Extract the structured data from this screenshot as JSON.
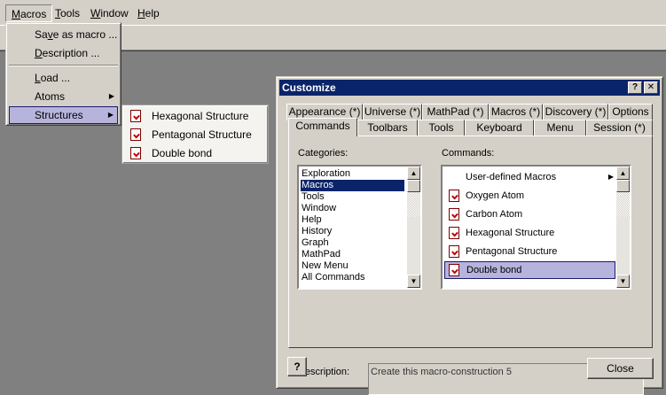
{
  "menubar": {
    "items": [
      {
        "label": "Macros",
        "mnemonic": "M",
        "rest": "acros"
      },
      {
        "label": "Tools",
        "mnemonic": "T",
        "rest": "ools"
      },
      {
        "label": "Window",
        "mnemonic": "W",
        "rest": "indow"
      },
      {
        "label": "Help",
        "mnemonic": "H",
        "rest": "elp"
      }
    ]
  },
  "macros_menu": {
    "save_as_macro": {
      "pre": "Sa",
      "mn": "v",
      "post": "e as macro ..."
    },
    "description": {
      "mn": "D",
      "post": "escription ..."
    },
    "load": {
      "mn": "L",
      "post": "oad ..."
    },
    "atoms": "Atoms",
    "structures": "Structures"
  },
  "structures_submenu": {
    "items": [
      "Hexagonal Structure",
      "Pentagonal Structure",
      "Double bond"
    ]
  },
  "dialog": {
    "title": "Customize",
    "help_btn": "?",
    "close_btn": "✕",
    "tabs_back": [
      "Appearance (*)",
      "Universe (*)",
      "MathPad (*)",
      "Macros (*)",
      "Discovery (*)",
      "Options"
    ],
    "tabs_front": [
      "Commands",
      "Toolbars",
      "Tools",
      "Keyboard",
      "Menu",
      "Session (*)"
    ],
    "categories_label": "Categories:",
    "categories": [
      "Exploration",
      "Macros",
      "Tools",
      "Window",
      "Help",
      "History",
      "Graph",
      "MathPad",
      "New Menu",
      "All Commands"
    ],
    "selected_category": "Macros",
    "commands_label": "Commands:",
    "commands": [
      "User-defined Macros",
      "Oxygen Atom",
      "Carbon Atom",
      "Hexagonal Structure",
      "Pentagonal Structure",
      "Double bond"
    ],
    "selected_command": "Double bond",
    "description_label": "Description:",
    "description_text": "Create this macro-construction 5",
    "help_button": "?",
    "close_button": "Close"
  },
  "colors": {
    "face": "#d4d0c8",
    "titlebar": "#0a246a",
    "highlight": "#b6b4dc",
    "desktop": "#808080"
  }
}
